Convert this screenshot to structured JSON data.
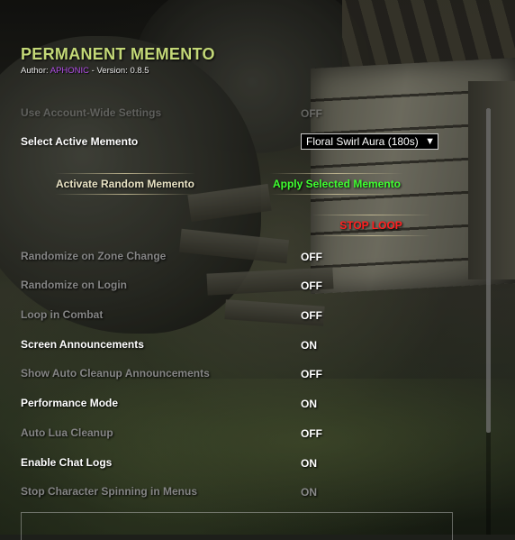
{
  "header": {
    "title": "PERMANENT MEMENTO",
    "author_prefix": "Author: ",
    "author_name": "APHONIC",
    "version_text": " - Version: 0.8.5"
  },
  "settings": {
    "account_wide": {
      "label": "Use Account-Wide Settings",
      "value": "OFF"
    },
    "select_memento": {
      "label": "Select Active Memento",
      "value": "Floral Swirl Aura (180s)"
    },
    "randomize_zone": {
      "label": "Randomize on Zone Change",
      "value": "OFF"
    },
    "randomize_login": {
      "label": "Randomize on Login",
      "value": "OFF"
    },
    "loop_combat": {
      "label": "Loop in Combat",
      "value": "OFF"
    },
    "screen_announcements": {
      "label": "Screen Announcements",
      "value": "ON"
    },
    "auto_cleanup_announcements": {
      "label": "Show Auto Cleanup Announcements",
      "value": "OFF"
    },
    "performance_mode": {
      "label": "Performance Mode",
      "value": "ON"
    },
    "auto_lua_cleanup": {
      "label": "Auto Lua Cleanup",
      "value": "OFF"
    },
    "chat_logs": {
      "label": "Enable Chat Logs",
      "value": "ON"
    },
    "stop_spinning": {
      "label": "Stop Character Spinning in Menus",
      "value": "ON"
    }
  },
  "buttons": {
    "activate_random": "Activate Random Memento",
    "apply_selected": "Apply Selected Memento",
    "stop_loop": "STOP LOOP"
  },
  "section": {
    "label": ""
  },
  "icons": {
    "dropdown_arrow": "▼"
  },
  "colors": {
    "title": "#c3d877",
    "author_name": "#b24ee8",
    "apply_button": "#3fff30",
    "stop_button": "#ff2020"
  }
}
